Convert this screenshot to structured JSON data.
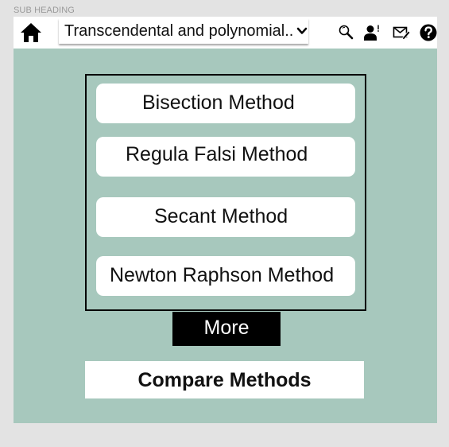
{
  "sub_heading": "SUB HEADING",
  "toolbar": {
    "home_icon": "home-icon",
    "dropdown": {
      "selected": "Transcendental and polynomial..",
      "icon": "chevron-down-icon"
    },
    "icons": [
      "search-icon",
      "user-alert-icon",
      "mail-edit-icon",
      "help-icon"
    ]
  },
  "methods": [
    {
      "label": "Bisection Method"
    },
    {
      "label": "Regula Falsi Method"
    },
    {
      "label": "Secant Method"
    },
    {
      "label": "Newton Raphson Method"
    }
  ],
  "more_label": "More",
  "compare_label": "Compare Methods",
  "colors": {
    "panel_background": "#a7c8bd",
    "page_background": "#e3e3e3",
    "more_button": "#000000"
  }
}
